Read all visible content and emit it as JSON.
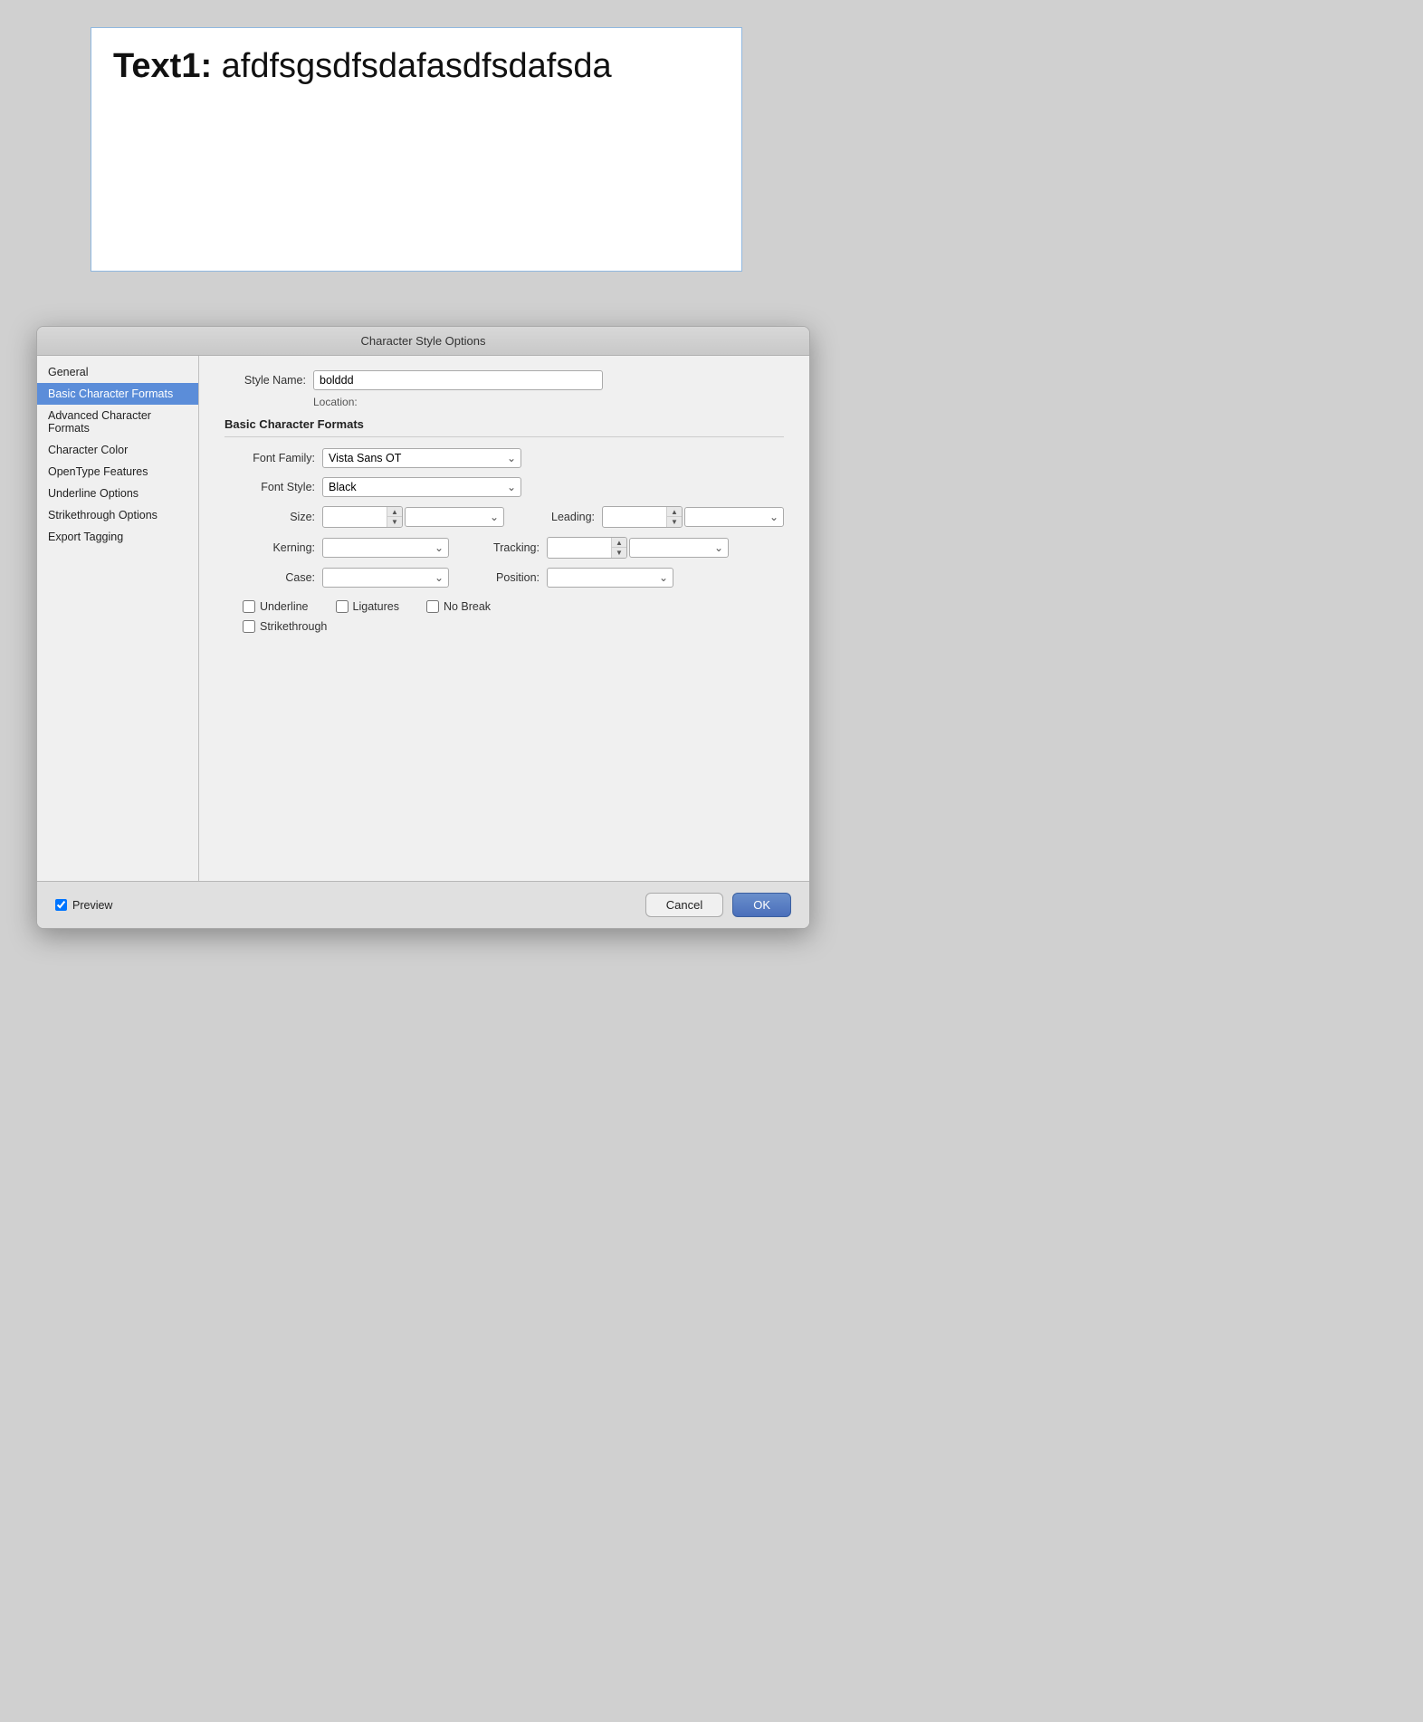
{
  "preview": {
    "text_bold": "Text1:",
    "text_normal": " afdfsgsdfsdafasdfsdafsda"
  },
  "dialog": {
    "title": "Character Style Options",
    "style_name_label": "Style Name:",
    "style_name_value": "bolddd",
    "location_label": "Location:",
    "section_title": "Basic Character Formats",
    "font_family_label": "Font Family:",
    "font_family_value": "Vista Sans OT",
    "font_style_label": "Font Style:",
    "font_style_value": "Black",
    "size_label": "Size:",
    "leading_label": "Leading:",
    "kerning_label": "Kerning:",
    "tracking_label": "Tracking:",
    "case_label": "Case:",
    "position_label": "Position:",
    "underline_label": "Underline",
    "ligatures_label": "Ligatures",
    "no_break_label": "No Break",
    "strikethrough_label": "Strikethrough",
    "preview_label": "Preview",
    "cancel_label": "Cancel",
    "ok_label": "OK"
  },
  "sidebar": {
    "items": [
      {
        "label": "General",
        "active": false
      },
      {
        "label": "Basic Character Formats",
        "active": true
      },
      {
        "label": "Advanced Character Formats",
        "active": false
      },
      {
        "label": "Character Color",
        "active": false
      },
      {
        "label": "OpenType Features",
        "active": false
      },
      {
        "label": "Underline Options",
        "active": false
      },
      {
        "label": "Strikethrough Options",
        "active": false
      },
      {
        "label": "Export Tagging",
        "active": false
      }
    ]
  }
}
